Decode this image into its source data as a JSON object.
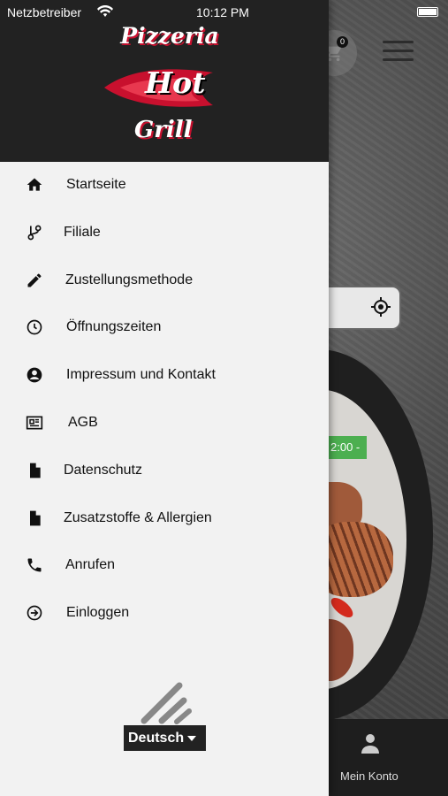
{
  "status_bar": {
    "carrier": "Netzbetreiber",
    "time": "10:12 PM"
  },
  "logo": {
    "line1": "Pizzeria",
    "line2": "Hot",
    "line3": "Grill"
  },
  "menu": {
    "items": [
      {
        "label": "Startseite",
        "icon": "home-icon"
      },
      {
        "label": "Filiale",
        "icon": "branch-icon"
      },
      {
        "label": "Zustellungsmethode",
        "icon": "pencil-icon"
      },
      {
        "label": "Öffnungszeiten",
        "icon": "clock-icon"
      },
      {
        "label": "Impressum und Kontakt",
        "icon": "account-circle-icon"
      },
      {
        "label": "AGB",
        "icon": "newspaper-icon"
      },
      {
        "label": "Datenschutz",
        "icon": "document-icon"
      },
      {
        "label": "Zusatzstoffe & Allergien",
        "icon": "document-icon"
      },
      {
        "label": "Anrufen",
        "icon": "phone-icon"
      },
      {
        "label": "Einloggen",
        "icon": "login-icon"
      }
    ]
  },
  "language": {
    "selected": "Deutsch"
  },
  "background_app": {
    "cart_count": "0",
    "time_chip": "2:00 -",
    "bottom_nav": {
      "account_label": "Mein Konto"
    }
  },
  "colors": {
    "drawer_bg": "#f2f2f2",
    "header_bg": "#222222",
    "brand_red": "#c8102e",
    "chip_green": "#4caf50"
  }
}
